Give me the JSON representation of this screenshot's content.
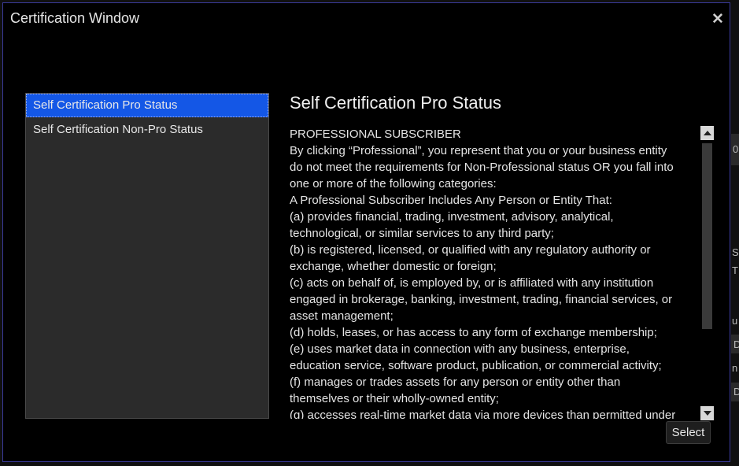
{
  "window": {
    "title": "Certification Window",
    "close_glyph": "✕",
    "border_color": "#3a3a9a"
  },
  "list": {
    "items": [
      {
        "label": "Self Certification Pro Status",
        "selected": true
      },
      {
        "label": "Self Certification Non-Pro Status",
        "selected": false
      }
    ],
    "selected_color": "#1457e6"
  },
  "detail": {
    "title": "Self Certification Pro Status",
    "lines": [
      "PROFESSIONAL SUBSCRIBER",
      "By clicking “Professional”, you represent that you or your business entity",
      "do not meet the requirements for Non-Professional status OR you fall into",
      "one or more of the following categories:",
      "A Professional Subscriber Includes Any Person or Entity That:",
      "(a) provides financial, trading, investment, advisory, analytical,",
      "technological, or similar services to any third party;",
      "(b) is registered, licensed, or qualified with any regulatory authority or",
      "exchange, whether domestic or foreign;",
      "(c) acts on behalf of, is employed by, or is affiliated with any institution",
      "engaged in brokerage, banking, investment, trading, financial services, or",
      "asset management;",
      "(d) holds, leases, or has access to any form of exchange membership;",
      "(e) uses market data in connection with any business, enterprise,",
      "education service, software product, publication, or commercial activity;",
      "(f) manages or trades assets for any person or entity other than",
      "themselves or their wholly-owned entity;",
      "(g) accesses real-time market data via more devices than permitted under"
    ]
  },
  "scrollbar": {
    "up_icon": "scroll-up-arrow",
    "down_icon": "scroll-down-arrow"
  },
  "buttons": {
    "select_label": "Select"
  },
  "background": {
    "fragments": [
      "0",
      "S",
      "T",
      "u",
      "D",
      "n",
      "D"
    ]
  }
}
